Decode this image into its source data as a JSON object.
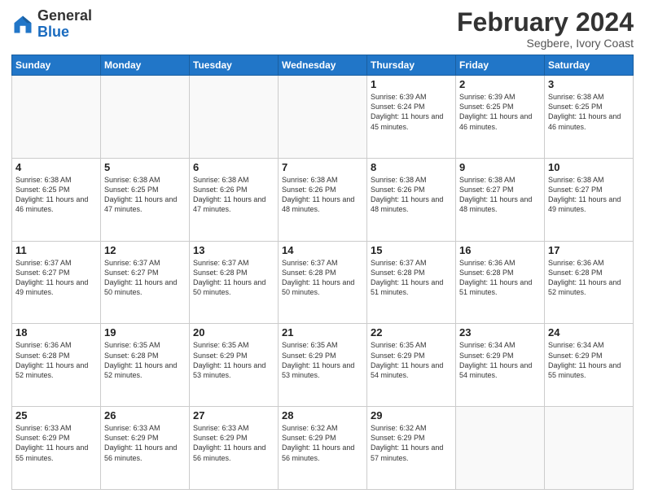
{
  "logo": {
    "general": "General",
    "blue": "Blue"
  },
  "header": {
    "month": "February 2024",
    "location": "Segbere, Ivory Coast"
  },
  "days_of_week": [
    "Sunday",
    "Monday",
    "Tuesday",
    "Wednesday",
    "Thursday",
    "Friday",
    "Saturday"
  ],
  "weeks": [
    [
      {
        "day": "",
        "info": ""
      },
      {
        "day": "",
        "info": ""
      },
      {
        "day": "",
        "info": ""
      },
      {
        "day": "",
        "info": ""
      },
      {
        "day": "1",
        "info": "Sunrise: 6:39 AM\nSunset: 6:24 PM\nDaylight: 11 hours\nand 45 minutes."
      },
      {
        "day": "2",
        "info": "Sunrise: 6:39 AM\nSunset: 6:25 PM\nDaylight: 11 hours\nand 46 minutes."
      },
      {
        "day": "3",
        "info": "Sunrise: 6:38 AM\nSunset: 6:25 PM\nDaylight: 11 hours\nand 46 minutes."
      }
    ],
    [
      {
        "day": "4",
        "info": "Sunrise: 6:38 AM\nSunset: 6:25 PM\nDaylight: 11 hours\nand 46 minutes."
      },
      {
        "day": "5",
        "info": "Sunrise: 6:38 AM\nSunset: 6:25 PM\nDaylight: 11 hours\nand 47 minutes."
      },
      {
        "day": "6",
        "info": "Sunrise: 6:38 AM\nSunset: 6:26 PM\nDaylight: 11 hours\nand 47 minutes."
      },
      {
        "day": "7",
        "info": "Sunrise: 6:38 AM\nSunset: 6:26 PM\nDaylight: 11 hours\nand 48 minutes."
      },
      {
        "day": "8",
        "info": "Sunrise: 6:38 AM\nSunset: 6:26 PM\nDaylight: 11 hours\nand 48 minutes."
      },
      {
        "day": "9",
        "info": "Sunrise: 6:38 AM\nSunset: 6:27 PM\nDaylight: 11 hours\nand 48 minutes."
      },
      {
        "day": "10",
        "info": "Sunrise: 6:38 AM\nSunset: 6:27 PM\nDaylight: 11 hours\nand 49 minutes."
      }
    ],
    [
      {
        "day": "11",
        "info": "Sunrise: 6:37 AM\nSunset: 6:27 PM\nDaylight: 11 hours\nand 49 minutes."
      },
      {
        "day": "12",
        "info": "Sunrise: 6:37 AM\nSunset: 6:27 PM\nDaylight: 11 hours\nand 50 minutes."
      },
      {
        "day": "13",
        "info": "Sunrise: 6:37 AM\nSunset: 6:28 PM\nDaylight: 11 hours\nand 50 minutes."
      },
      {
        "day": "14",
        "info": "Sunrise: 6:37 AM\nSunset: 6:28 PM\nDaylight: 11 hours\nand 50 minutes."
      },
      {
        "day": "15",
        "info": "Sunrise: 6:37 AM\nSunset: 6:28 PM\nDaylight: 11 hours\nand 51 minutes."
      },
      {
        "day": "16",
        "info": "Sunrise: 6:36 AM\nSunset: 6:28 PM\nDaylight: 11 hours\nand 51 minutes."
      },
      {
        "day": "17",
        "info": "Sunrise: 6:36 AM\nSunset: 6:28 PM\nDaylight: 11 hours\nand 52 minutes."
      }
    ],
    [
      {
        "day": "18",
        "info": "Sunrise: 6:36 AM\nSunset: 6:28 PM\nDaylight: 11 hours\nand 52 minutes."
      },
      {
        "day": "19",
        "info": "Sunrise: 6:35 AM\nSunset: 6:28 PM\nDaylight: 11 hours\nand 52 minutes."
      },
      {
        "day": "20",
        "info": "Sunrise: 6:35 AM\nSunset: 6:29 PM\nDaylight: 11 hours\nand 53 minutes."
      },
      {
        "day": "21",
        "info": "Sunrise: 6:35 AM\nSunset: 6:29 PM\nDaylight: 11 hours\nand 53 minutes."
      },
      {
        "day": "22",
        "info": "Sunrise: 6:35 AM\nSunset: 6:29 PM\nDaylight: 11 hours\nand 54 minutes."
      },
      {
        "day": "23",
        "info": "Sunrise: 6:34 AM\nSunset: 6:29 PM\nDaylight: 11 hours\nand 54 minutes."
      },
      {
        "day": "24",
        "info": "Sunrise: 6:34 AM\nSunset: 6:29 PM\nDaylight: 11 hours\nand 55 minutes."
      }
    ],
    [
      {
        "day": "25",
        "info": "Sunrise: 6:33 AM\nSunset: 6:29 PM\nDaylight: 11 hours\nand 55 minutes."
      },
      {
        "day": "26",
        "info": "Sunrise: 6:33 AM\nSunset: 6:29 PM\nDaylight: 11 hours\nand 56 minutes."
      },
      {
        "day": "27",
        "info": "Sunrise: 6:33 AM\nSunset: 6:29 PM\nDaylight: 11 hours\nand 56 minutes."
      },
      {
        "day": "28",
        "info": "Sunrise: 6:32 AM\nSunset: 6:29 PM\nDaylight: 11 hours\nand 56 minutes."
      },
      {
        "day": "29",
        "info": "Sunrise: 6:32 AM\nSunset: 6:29 PM\nDaylight: 11 hours\nand 57 minutes."
      },
      {
        "day": "",
        "info": ""
      },
      {
        "day": "",
        "info": ""
      }
    ]
  ]
}
